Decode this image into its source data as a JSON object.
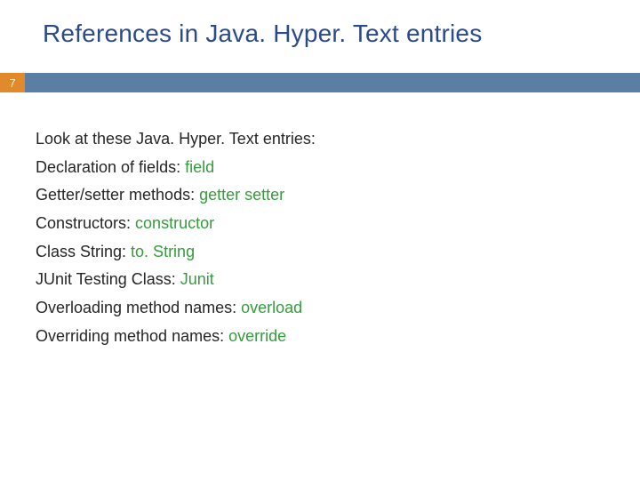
{
  "title": "References in Java. Hyper. Text entries",
  "pageNumber": "7",
  "intro": "Look at these Java. Hyper. Text entries:",
  "lines": [
    {
      "label": "Declaration of fields: ",
      "keywords": "field"
    },
    {
      "label": "Getter/setter methods: ",
      "keywords": "getter setter"
    },
    {
      "label": "Constructors: ",
      "keywords": "constructor"
    },
    {
      "label": "Class String: ",
      "keywords": "to. String"
    },
    {
      "label": "JUnit Testing Class: ",
      "keywords": "Junit"
    },
    {
      "label": "Overloading method names: ",
      "keywords": "overload"
    },
    {
      "label": "Overriding method names: ",
      "keywords": "override"
    }
  ]
}
